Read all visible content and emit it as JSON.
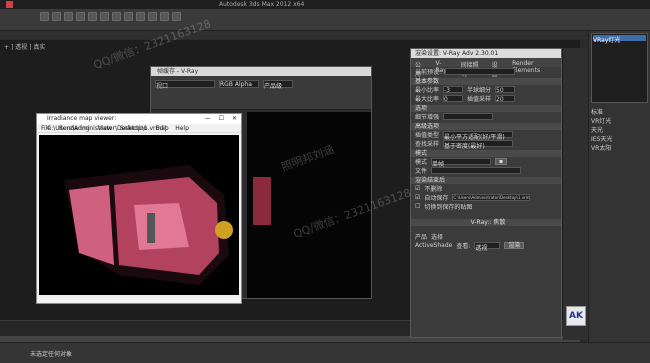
{
  "app": {
    "title": "Autodesk 3ds Max  2012 x64"
  },
  "viewport": {
    "label": "+ ] 透视 ] 真实"
  },
  "vfb": {
    "title": "帧缓存 - V-Ray",
    "alpha_label": "RGB Alpha",
    "dropdown": "视口",
    "preset": "产品级"
  },
  "irradiance": {
    "title": "Irradiance map viewer: C:\\Users\\Administrator\\Desktop\\1.vrmap",
    "menu": [
      "File",
      "Rendering",
      "View",
      "Selection",
      "Edit",
      "Help"
    ],
    "buttons": [
      "—",
      "☐",
      "✕"
    ]
  },
  "render_setup": {
    "title": "渲染设置: V-Ray Adv 2.30.01",
    "tabs": [
      "公用",
      "V-Ray",
      "间接照明",
      "设置",
      "Render Elements"
    ],
    "preset_label": "当前预设:",
    "rows": [
      {
        "label": "基本参数"
      },
      {
        "label": "最小比率",
        "value": "-3"
      },
      {
        "label": "最大比率",
        "value": "0"
      },
      {
        "label": "半球细分",
        "value": "50"
      },
      {
        "label": "插值采样",
        "value": "20"
      },
      {
        "label": "选项"
      },
      {
        "label": "细节增强"
      },
      {
        "label": "高级选项"
      },
      {
        "label": "插值类型",
        "value": "最小平方适配(好/平滑)"
      },
      {
        "label": "查找采样",
        "value": "基于密度(最好)"
      },
      {
        "label": "模式"
      },
      {
        "label": "模式",
        "value": "单帧"
      },
      {
        "label": "文件"
      },
      {
        "label": "渲染结束后"
      },
      {
        "label": "不删除"
      },
      {
        "label": "自动保存",
        "value": "C:\\Users\\Administrator\\Desktop\\1.vrmap"
      },
      {
        "label": "切换到保存的贴图"
      }
    ],
    "section": "V-Ray:: 焦散",
    "product_label": "产品",
    "active_shade": "ActiveShade",
    "preset_value": "选择",
    "view_label": "查看:",
    "view_value": "透视",
    "render_button": "渲染"
  },
  "command_panel": {
    "selected": "VRay灯光",
    "items": [
      "标准",
      "VR灯光",
      "天光",
      "IES天光",
      "VR太阳"
    ]
  },
  "logo": "AK",
  "watermarks": [
    "照明邦刘涵",
    "QQ/微信：2321163128"
  ],
  "status": {
    "text": "未选定任何对象"
  }
}
